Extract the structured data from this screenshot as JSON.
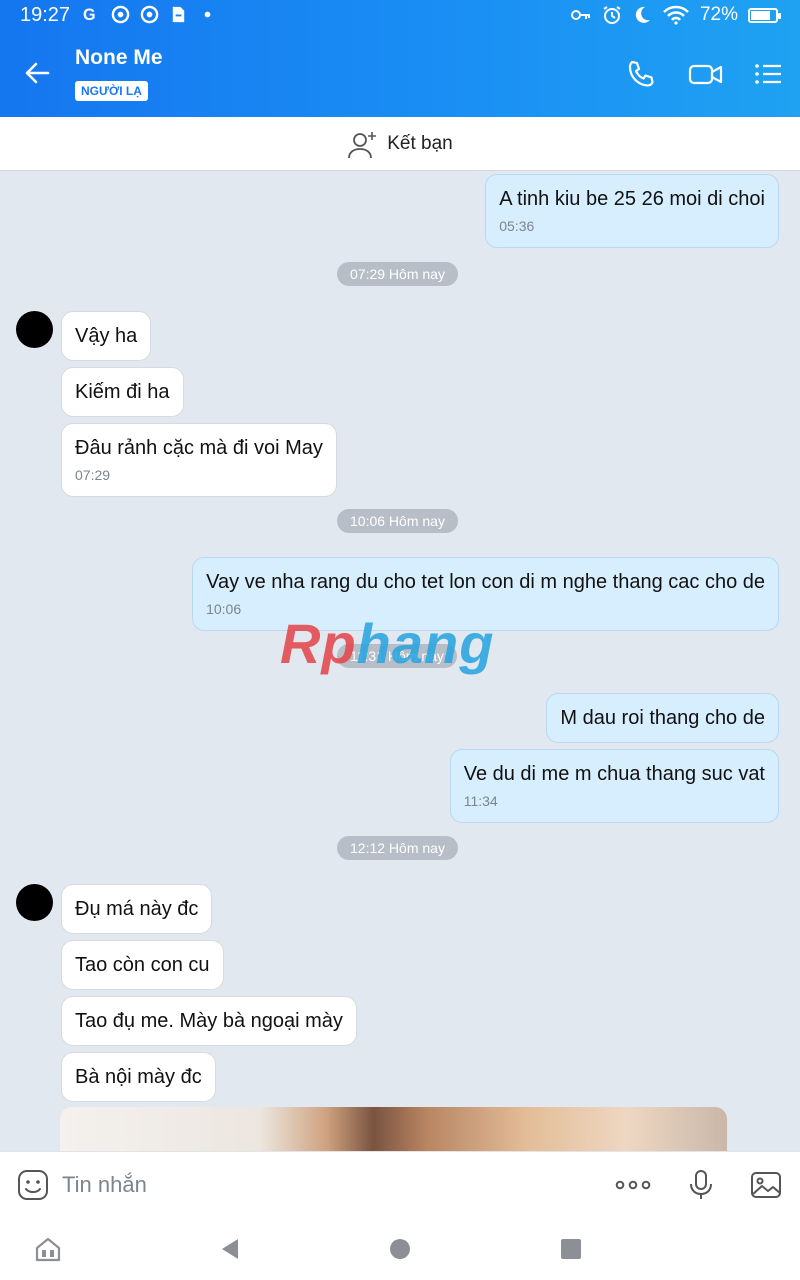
{
  "status_bar": {
    "time": "19:27",
    "battery": "72%",
    "battery_level": 0.72
  },
  "header": {
    "contact_name": "None Me",
    "badge": "NGƯỜI LẠ"
  },
  "add_friend": {
    "label": "Kết bạn"
  },
  "messages": [
    {
      "dir": "out",
      "text": "A tinh kiu be 25 26 moi di choi",
      "time": "05:36"
    },
    {
      "pill": "07:29 Hôm nay"
    },
    {
      "dir": "in",
      "text": "Vậy ha"
    },
    {
      "dir": "in",
      "text": "Kiếm đi ha"
    },
    {
      "dir": "in",
      "text": "Đâu rảnh cặc mà đi voi May",
      "time": "07:29"
    },
    {
      "pill": "10:06 Hôm nay"
    },
    {
      "dir": "out",
      "text": "Vay ve nha rang du cho tet lon con di m nghe thang cac cho de",
      "time": "10:06"
    },
    {
      "pill": "11:31 Hôm nay"
    },
    {
      "dir": "out",
      "text": "M dau roi thang cho de"
    },
    {
      "dir": "out",
      "text": "Ve du di me m chua thang suc vat",
      "time": "11:34"
    },
    {
      "pill": "12:12 Hôm nay"
    },
    {
      "dir": "in",
      "text": "Đụ má này đc"
    },
    {
      "dir": "in",
      "text": "Tao còn con cu"
    },
    {
      "dir": "in",
      "text": "Tao đụ me. Mày bà ngoại mày"
    },
    {
      "dir": "in",
      "text": "Bà nội mày đc"
    }
  ],
  "watermark": {
    "left": "Rp",
    "right": "hang"
  },
  "input": {
    "placeholder": "Tin nhắn"
  }
}
